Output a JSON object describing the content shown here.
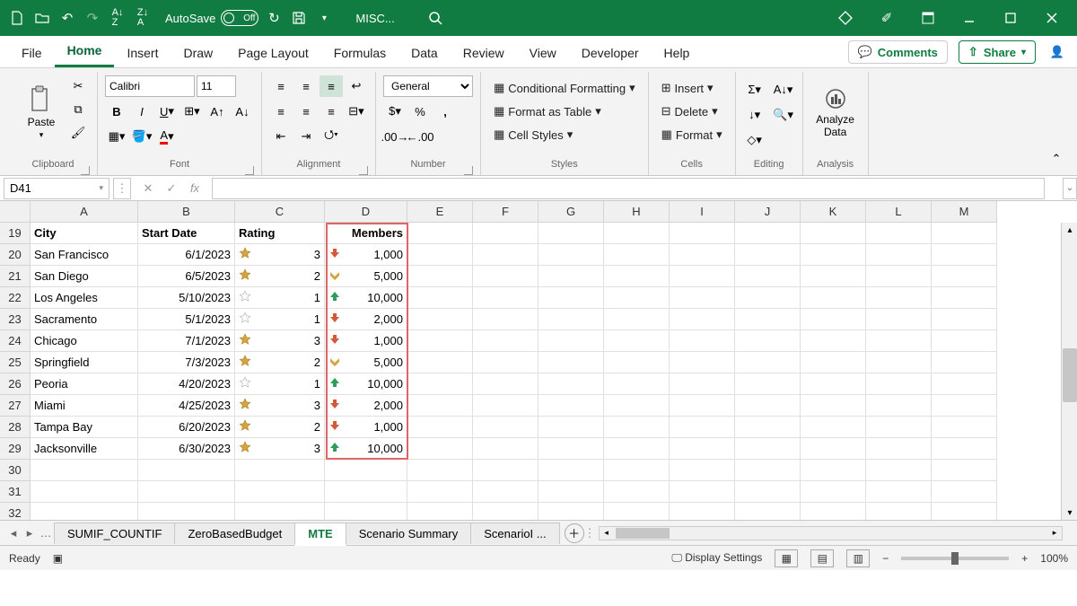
{
  "titlebar": {
    "autosave_label": "AutoSave",
    "autosave_state": "Off",
    "doc_title": "MISC..."
  },
  "tabs": {
    "file": "File",
    "home": "Home",
    "insert": "Insert",
    "draw": "Draw",
    "page_layout": "Page Layout",
    "formulas": "Formulas",
    "data": "Data",
    "review": "Review",
    "view": "View",
    "developer": "Developer",
    "help": "Help",
    "comments": "Comments",
    "share": "Share"
  },
  "ribbon": {
    "paste_label": "Paste",
    "clipboard_label": "Clipboard",
    "font_name": "Calibri",
    "font_size": "11",
    "font_label": "Font",
    "alignment_label": "Alignment",
    "number_format": "General",
    "number_label": "Number",
    "conditional": "Conditional Formatting",
    "format_table": "Format as Table",
    "cell_styles": "Cell Styles",
    "styles_label": "Styles",
    "insert": "Insert",
    "delete": "Delete",
    "format": "Format",
    "cells_label": "Cells",
    "editing_label": "Editing",
    "analyze": "Analyze Data",
    "analysis_label": "Analysis"
  },
  "namebox": "D41",
  "columns": [
    "A",
    "B",
    "C",
    "D",
    "E",
    "F",
    "G",
    "H",
    "I",
    "J",
    "K",
    "L",
    "M"
  ],
  "rows": [
    {
      "n": 19,
      "a": "City",
      "b": "Start Date",
      "c": "Rating",
      "d": "Members",
      "bold": true
    },
    {
      "n": 20,
      "a": "San Francisco",
      "b": "6/1/2023",
      "c": "3",
      "d": "1,000",
      "star": "gold",
      "arrow": "down"
    },
    {
      "n": 21,
      "a": "San Diego",
      "b": "6/5/2023",
      "c": "2",
      "d": "5,000",
      "star": "half",
      "arrow": "side"
    },
    {
      "n": 22,
      "a": "Los Angeles",
      "b": "5/10/2023",
      "c": "1",
      "d": "10,000",
      "star": "empty",
      "arrow": "up"
    },
    {
      "n": 23,
      "a": "Sacramento",
      "b": "5/1/2023",
      "c": "1",
      "d": "2,000",
      "star": "empty",
      "arrow": "down"
    },
    {
      "n": 24,
      "a": "Chicago",
      "b": "7/1/2023",
      "c": "3",
      "d": "1,000",
      "star": "gold",
      "arrow": "down"
    },
    {
      "n": 25,
      "a": "Springfield",
      "b": "7/3/2023",
      "c": "2",
      "d": "5,000",
      "star": "half",
      "arrow": "side"
    },
    {
      "n": 26,
      "a": "Peoria",
      "b": "4/20/2023",
      "c": "1",
      "d": "10,000",
      "star": "empty",
      "arrow": "up"
    },
    {
      "n": 27,
      "a": "Miami",
      "b": "4/25/2023",
      "c": "3",
      "d": "2,000",
      "star": "gold",
      "arrow": "down"
    },
    {
      "n": 28,
      "a": "Tampa Bay",
      "b": "6/20/2023",
      "c": "2",
      "d": "1,000",
      "star": "half",
      "arrow": "down"
    },
    {
      "n": 29,
      "a": "Jacksonville",
      "b": "6/30/2023",
      "c": "3",
      "d": "10,000",
      "star": "gold",
      "arrow": "up"
    },
    {
      "n": 30
    },
    {
      "n": 31
    },
    {
      "n": 32
    }
  ],
  "sheets": {
    "s1": "SUMIF_COUNTIF",
    "s2": "ZeroBasedBudget",
    "s3": "MTE",
    "s4": "Scenario Summary",
    "s5": "ScenarioI ..."
  },
  "status": {
    "ready": "Ready",
    "display": "Display Settings",
    "zoom": "100%"
  }
}
